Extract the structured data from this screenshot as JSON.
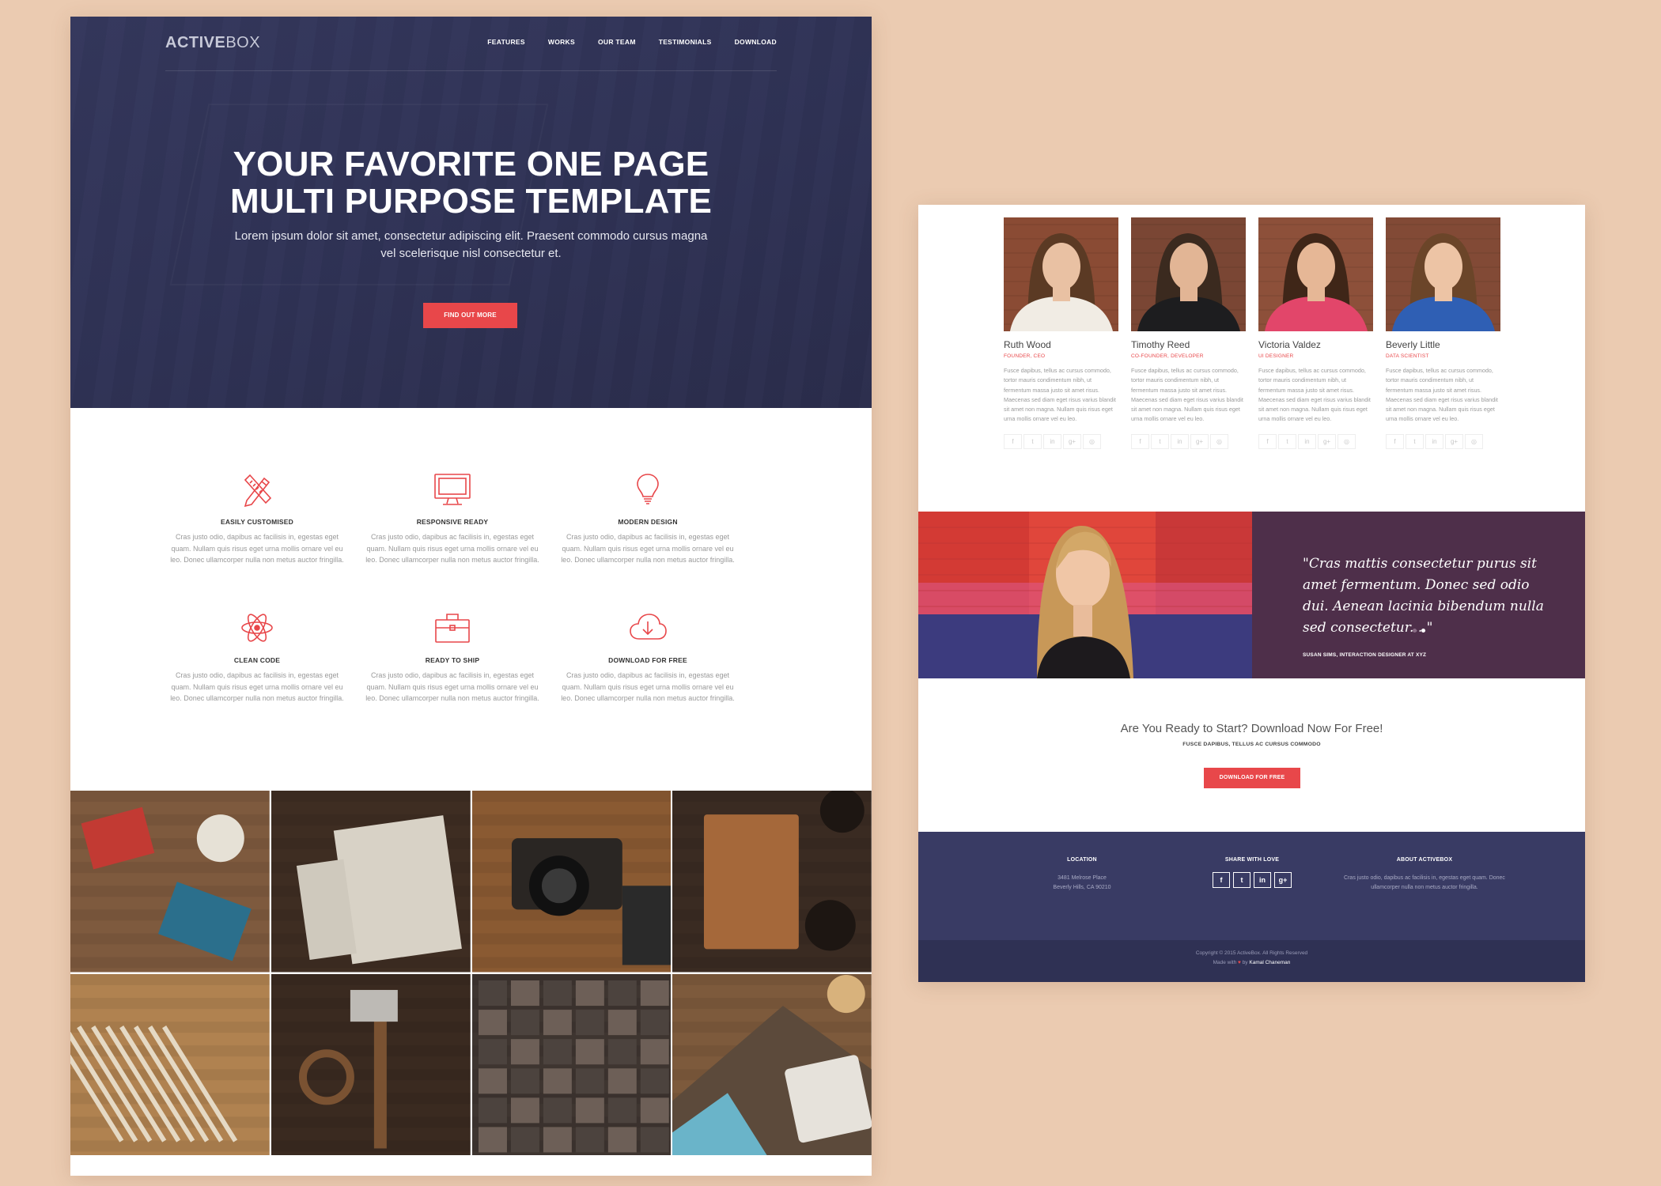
{
  "left": {
    "brand": {
      "bold": "ACTIVE",
      "light": "BOX"
    },
    "nav": [
      "FEATURES",
      "WORKS",
      "OUR TEAM",
      "TESTIMONIALS",
      "DOWNLOAD"
    ],
    "hero": {
      "title_line1": "YOUR FAVORITE ONE PAGE",
      "title_line2": "MULTI PURPOSE TEMPLATE",
      "subtitle": "Lorem ipsum dolor sit amet, consectetur adipiscing elit. Praesent commodo cursus magna vel scelerisque nisl consectetur et.",
      "button": "FIND OUT MORE"
    },
    "features": [
      {
        "title": "EASILY CUSTOMISED",
        "icon": "pencil-ruler-icon",
        "text": "Cras justo odio, dapibus ac facilisis in, egestas eget quam. Nullam quis risus eget urna mollis ornare vel eu leo. Donec ullamcorper nulla non metus auctor fringilla."
      },
      {
        "title": "RESPONSIVE READY",
        "icon": "monitor-icon",
        "text": "Cras justo odio, dapibus ac facilisis in, egestas eget quam. Nullam quis risus eget urna mollis ornare vel eu leo. Donec ullamcorper nulla non metus auctor fringilla."
      },
      {
        "title": "MODERN DESIGN",
        "icon": "lightbulb-icon",
        "text": "Cras justo odio, dapibus ac facilisis in, egestas eget quam. Nullam quis risus eget urna mollis ornare vel eu leo. Donec ullamcorper nulla non metus auctor fringilla."
      },
      {
        "title": "CLEAN CODE",
        "icon": "atom-icon",
        "text": "Cras justo odio, dapibus ac facilisis in, egestas eget quam. Nullam quis risus eget urna mollis ornare vel eu leo. Donec ullamcorper nulla non metus auctor fringilla."
      },
      {
        "title": "READY TO SHIP",
        "icon": "briefcase-icon",
        "text": "Cras justo odio, dapibus ac facilisis in, egestas eget quam. Nullam quis risus eget urna mollis ornare vel eu leo. Donec ullamcorper nulla non metus auctor fringilla."
      },
      {
        "title": "DOWNLOAD FOR FREE",
        "icon": "cloud-download-icon",
        "text": "Cras justo odio, dapibus ac facilisis in, egestas eget quam. Nullam quis risus eget urna mollis ornare vel eu leo. Donec ullamcorper nulla non metus auctor fringilla."
      }
    ],
    "gallery": [
      {
        "name": "gallery-stationery-flatlay",
        "base": "#7e5a3e",
        "accent": "#c23a33"
      },
      {
        "name": "gallery-dont-just-stand-there-book",
        "base": "#3e2d22",
        "accent": "#d8d2c6"
      },
      {
        "name": "gallery-vintage-camera",
        "base": "#8a5a32",
        "accent": "#2a2623"
      },
      {
        "name": "gallery-wooden-box",
        "base": "#3a2b22",
        "accent": "#a5683a"
      },
      {
        "name": "gallery-pencils",
        "base": "#b08250",
        "accent": "#e5d9c4"
      },
      {
        "name": "gallery-hand-tools",
        "base": "#3a2a20",
        "accent": "#7a5232"
      },
      {
        "name": "gallery-letterpress-type",
        "base": "#3e3530",
        "accent": "#6d5f57"
      },
      {
        "name": "gallery-coffee-table",
        "base": "#7d5a3c",
        "accent": "#e6e2db"
      }
    ]
  },
  "right": {
    "team": [
      {
        "name": "Ruth Wood",
        "role": "FOUNDER, CEO",
        "bio": "Fusce dapibus, tellus ac cursus commodo, tortor mauris condimentum nibh, ut fermentum massa justo sit amet risus. Maecenas sed diam eget risus varius blandit sit amet non magna. Nullam quis risus eget urna mollis ornare vel eu leo.",
        "hair": "#5b3a24",
        "shirt": "#f1ece4",
        "skin": "#e9c1a3",
        "wall": "#8a4b34"
      },
      {
        "name": "Timothy Reed",
        "role": "CO-FOUNDER, DEVELOPER",
        "bio": "Fusce dapibus, tellus ac cursus commodo, tortor mauris condimentum nibh, ut fermentum massa justo sit amet risus. Maecenas sed diam eget risus varius blandit sit amet non magna. Nullam quis risus eget urna mollis ornare vel eu leo.",
        "hair": "#3b2a1f",
        "shirt": "#1d1d1f",
        "skin": "#e2b595",
        "wall": "#7a4634"
      },
      {
        "name": "Victoria Valdez",
        "role": "UI DESIGNER",
        "bio": "Fusce dapibus, tellus ac cursus commodo, tortor mauris condimentum nibh, ut fermentum massa justo sit amet risus. Maecenas sed diam eget risus varius blandit sit amet non magna. Nullam quis risus eget urna mollis ornare vel eu leo.",
        "hair": "#3f2618",
        "shirt": "#e2466a",
        "skin": "#e6b796",
        "wall": "#8d503a"
      },
      {
        "name": "Beverly Little",
        "role": "DATA SCIENTIST",
        "bio": "Fusce dapibus, tellus ac cursus commodo, tortor mauris condimentum nibh, ut fermentum massa justo sit amet risus. Maecenas sed diam eget risus varius blandit sit amet non magna. Nullam quis risus eget urna mollis ornare vel eu leo.",
        "hair": "#6b4529",
        "shirt": "#2f5fb4",
        "skin": "#edc4a5",
        "wall": "#824a36"
      }
    ],
    "social_glyphs": [
      "f",
      "t",
      "in",
      "g+",
      "◎"
    ],
    "testimonial": {
      "quote": "\"Cras mattis consectetur purus sit amet fermentum. Donec sed odio dui. Aenean lacinia bibendum nulla sed consectetur....\"",
      "author": "SUSAN SIMS, INTERACTION DESIGNER AT XYZ"
    },
    "cta": {
      "title": "Are You Ready to Start? Download Now For Free!",
      "subtitle": "FUSCE DAPIBUS, TELLUS AC CURSUS COMMODO",
      "button": "DOWNLOAD FOR FREE"
    },
    "footer": {
      "location_title": "LOCATION",
      "address_line1": "3481 Melrose Place",
      "address_line2": "Beverly Hills, CA 90210",
      "share_title": "SHARE WITH LOVE",
      "share_glyphs": [
        "f",
        "t",
        "in",
        "g+"
      ],
      "about_title": "ABOUT ACTIVEBOX",
      "about_text": "Cras justo odio, dapibus ac facilisis in, egestas eget quam. Donec ullamcorper nulla non metus auctor fringilla.",
      "copyright": "Copyright © 2015 ActiveBox. All Rights Reserved",
      "made_with": "Made with",
      "made_by": "by",
      "author": "Kamal Chaneman"
    }
  },
  "colors": {
    "accent": "#e8474a",
    "hero_navy": "#2f3255",
    "footer_navy": "#393b64",
    "testimonial_plum": "#4e2f4a"
  }
}
